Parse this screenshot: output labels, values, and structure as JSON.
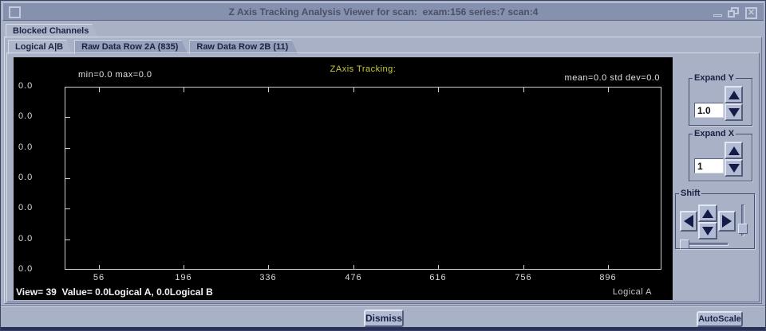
{
  "window": {
    "title": "Z Axis Tracking Analysis Viewer for scan:  exam:156 series:7 scan:4",
    "close_glyph": "✕"
  },
  "outer_tabs": [
    {
      "label": "Blocked Channels",
      "selected": true
    }
  ],
  "inner_tabs": [
    {
      "label": "Logical A|B",
      "selected": true
    },
    {
      "label": "Raw Data Row 2A (835)",
      "selected": false
    },
    {
      "label": "Raw Data Row 2B (11)",
      "selected": false
    }
  ],
  "chart_data": {
    "type": "line",
    "title": "ZAxis Tracking:",
    "annotations": {
      "top_left": "min=0.0 max=0.0",
      "top_right": "mean=0.0 std dev=0.0",
      "bottom_left": "View= 39  Value= 0.0Logical A, 0.0Logical B",
      "bottom_right": "Logical A"
    },
    "x_axis": {
      "range": [
        0,
        984
      ],
      "ticks": [
        56,
        196,
        336,
        476,
        616,
        756,
        896
      ]
    },
    "y_axis": {
      "tick_labels": [
        "0.0",
        "0.0",
        "0.0",
        "0.0",
        "0.0",
        "0.0",
        "0.0"
      ]
    },
    "series": [
      {
        "name": "Logical A",
        "values": []
      }
    ],
    "layout": {
      "grid": false,
      "plot_background": "#000000"
    },
    "colors": {
      "title": "#cbcb3f",
      "text": "#e3e3e3",
      "axis": "#cfcfcf"
    }
  },
  "controls": {
    "expand_y": {
      "label": "Expand Y",
      "value": "1.0"
    },
    "expand_x": {
      "label": "Expand X",
      "value": "1"
    },
    "shift": {
      "label": "Shift"
    },
    "autoscale_label": "AutoScale",
    "dismiss_label": "Dismiss"
  }
}
